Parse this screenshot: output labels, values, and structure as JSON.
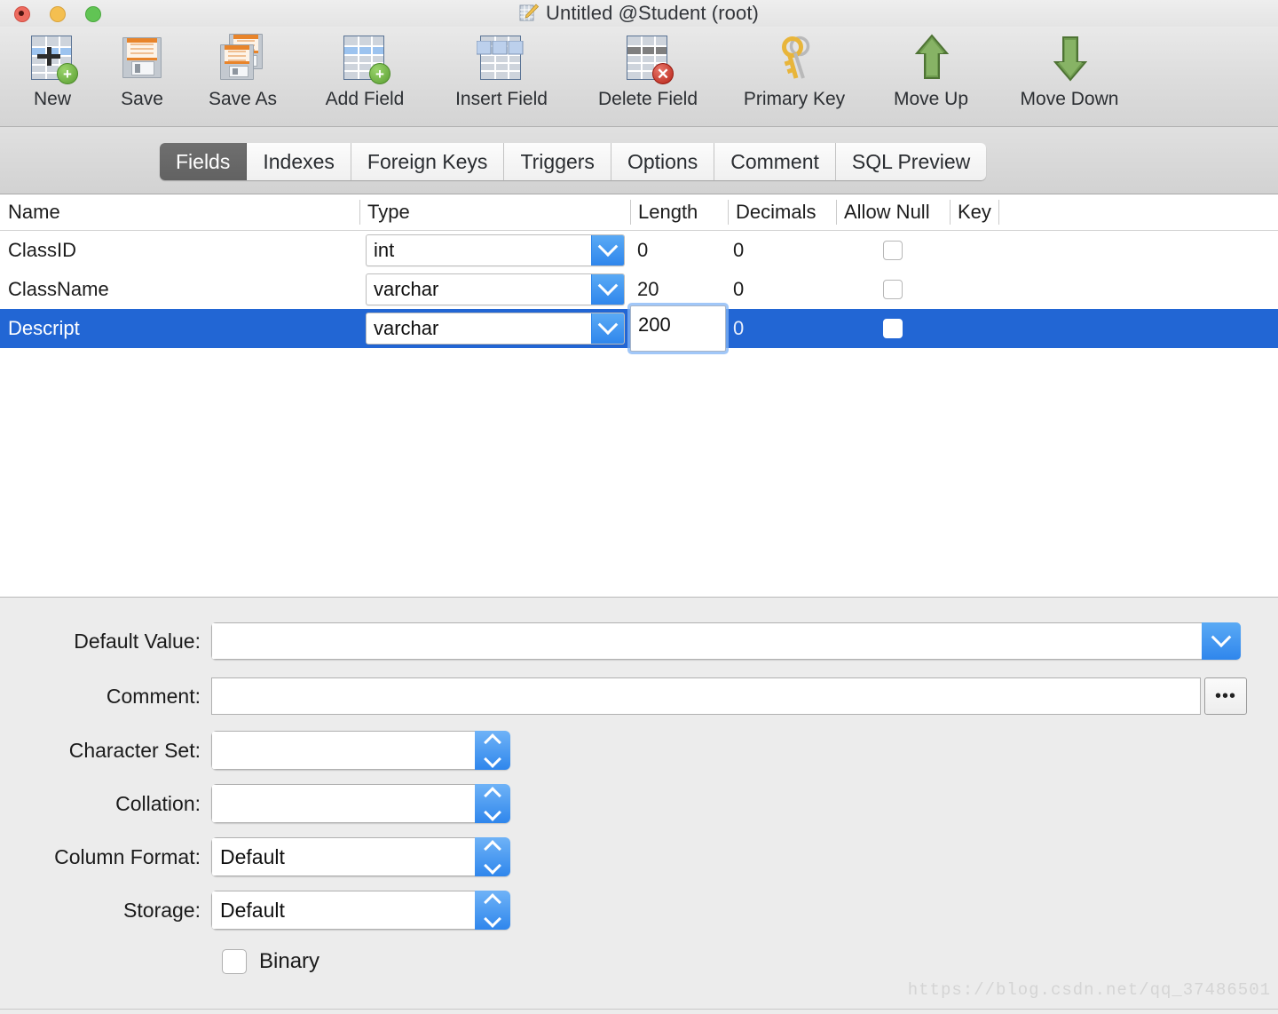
{
  "window": {
    "title": "Untitled @Student (root)",
    "title_icon": "table-edit-icon",
    "controls": {
      "close": "close-button",
      "minimize": "minimize-button",
      "maximize": "maximize-button"
    }
  },
  "toolbar": {
    "items": [
      {
        "label": "New",
        "icon": "new-table-icon"
      },
      {
        "label": "Save",
        "icon": "save-floppy-icon"
      },
      {
        "label": "Save As",
        "icon": "save-as-floppy-icon"
      },
      {
        "label": "Add Field",
        "icon": "add-field-icon"
      },
      {
        "label": "Insert Field",
        "icon": "insert-field-icon"
      },
      {
        "label": "Delete Field",
        "icon": "delete-field-icon"
      },
      {
        "label": "Primary Key",
        "icon": "key-icon"
      },
      {
        "label": "Move Up",
        "icon": "arrow-up-icon"
      },
      {
        "label": "Move Down",
        "icon": "arrow-down-icon"
      }
    ]
  },
  "tabs": {
    "active": "Fields",
    "items": [
      {
        "label": "Fields"
      },
      {
        "label": "Indexes"
      },
      {
        "label": "Foreign Keys"
      },
      {
        "label": "Triggers"
      },
      {
        "label": "Options"
      },
      {
        "label": "Comment"
      },
      {
        "label": "SQL Preview"
      }
    ]
  },
  "grid": {
    "columns": [
      "Name",
      "Type",
      "Length",
      "Decimals",
      "Allow Null",
      "Key"
    ],
    "rows": [
      {
        "name": "ClassID",
        "type": "int",
        "length": "0",
        "decimals": "0",
        "allow_null": false,
        "key": "",
        "selected": false
      },
      {
        "name": "ClassName",
        "type": "varchar",
        "length": "20",
        "decimals": "0",
        "allow_null": false,
        "key": "",
        "selected": false
      },
      {
        "name": "Descript",
        "type": "varchar",
        "length": "200",
        "decimals": "0",
        "allow_null": false,
        "key": "",
        "selected": true,
        "length_editing": true
      }
    ]
  },
  "panel": {
    "default_value": {
      "label": "Default Value:",
      "value": ""
    },
    "comment": {
      "label": "Comment:",
      "value": "",
      "browse_label": "•••"
    },
    "character_set": {
      "label": "Character Set:",
      "value": ""
    },
    "collation": {
      "label": "Collation:",
      "value": ""
    },
    "column_format": {
      "label": "Column Format:",
      "value": "Default"
    },
    "storage": {
      "label": "Storage:",
      "value": "Default"
    },
    "binary": {
      "label": "Binary",
      "checked": false
    }
  },
  "watermark": "https://blog.csdn.net/qq_37486501",
  "colors": {
    "selection_blue": "#2266d4",
    "accent_blue": "#2f86ec",
    "tab_active": "#626262",
    "panel_bg": "#ececec"
  }
}
